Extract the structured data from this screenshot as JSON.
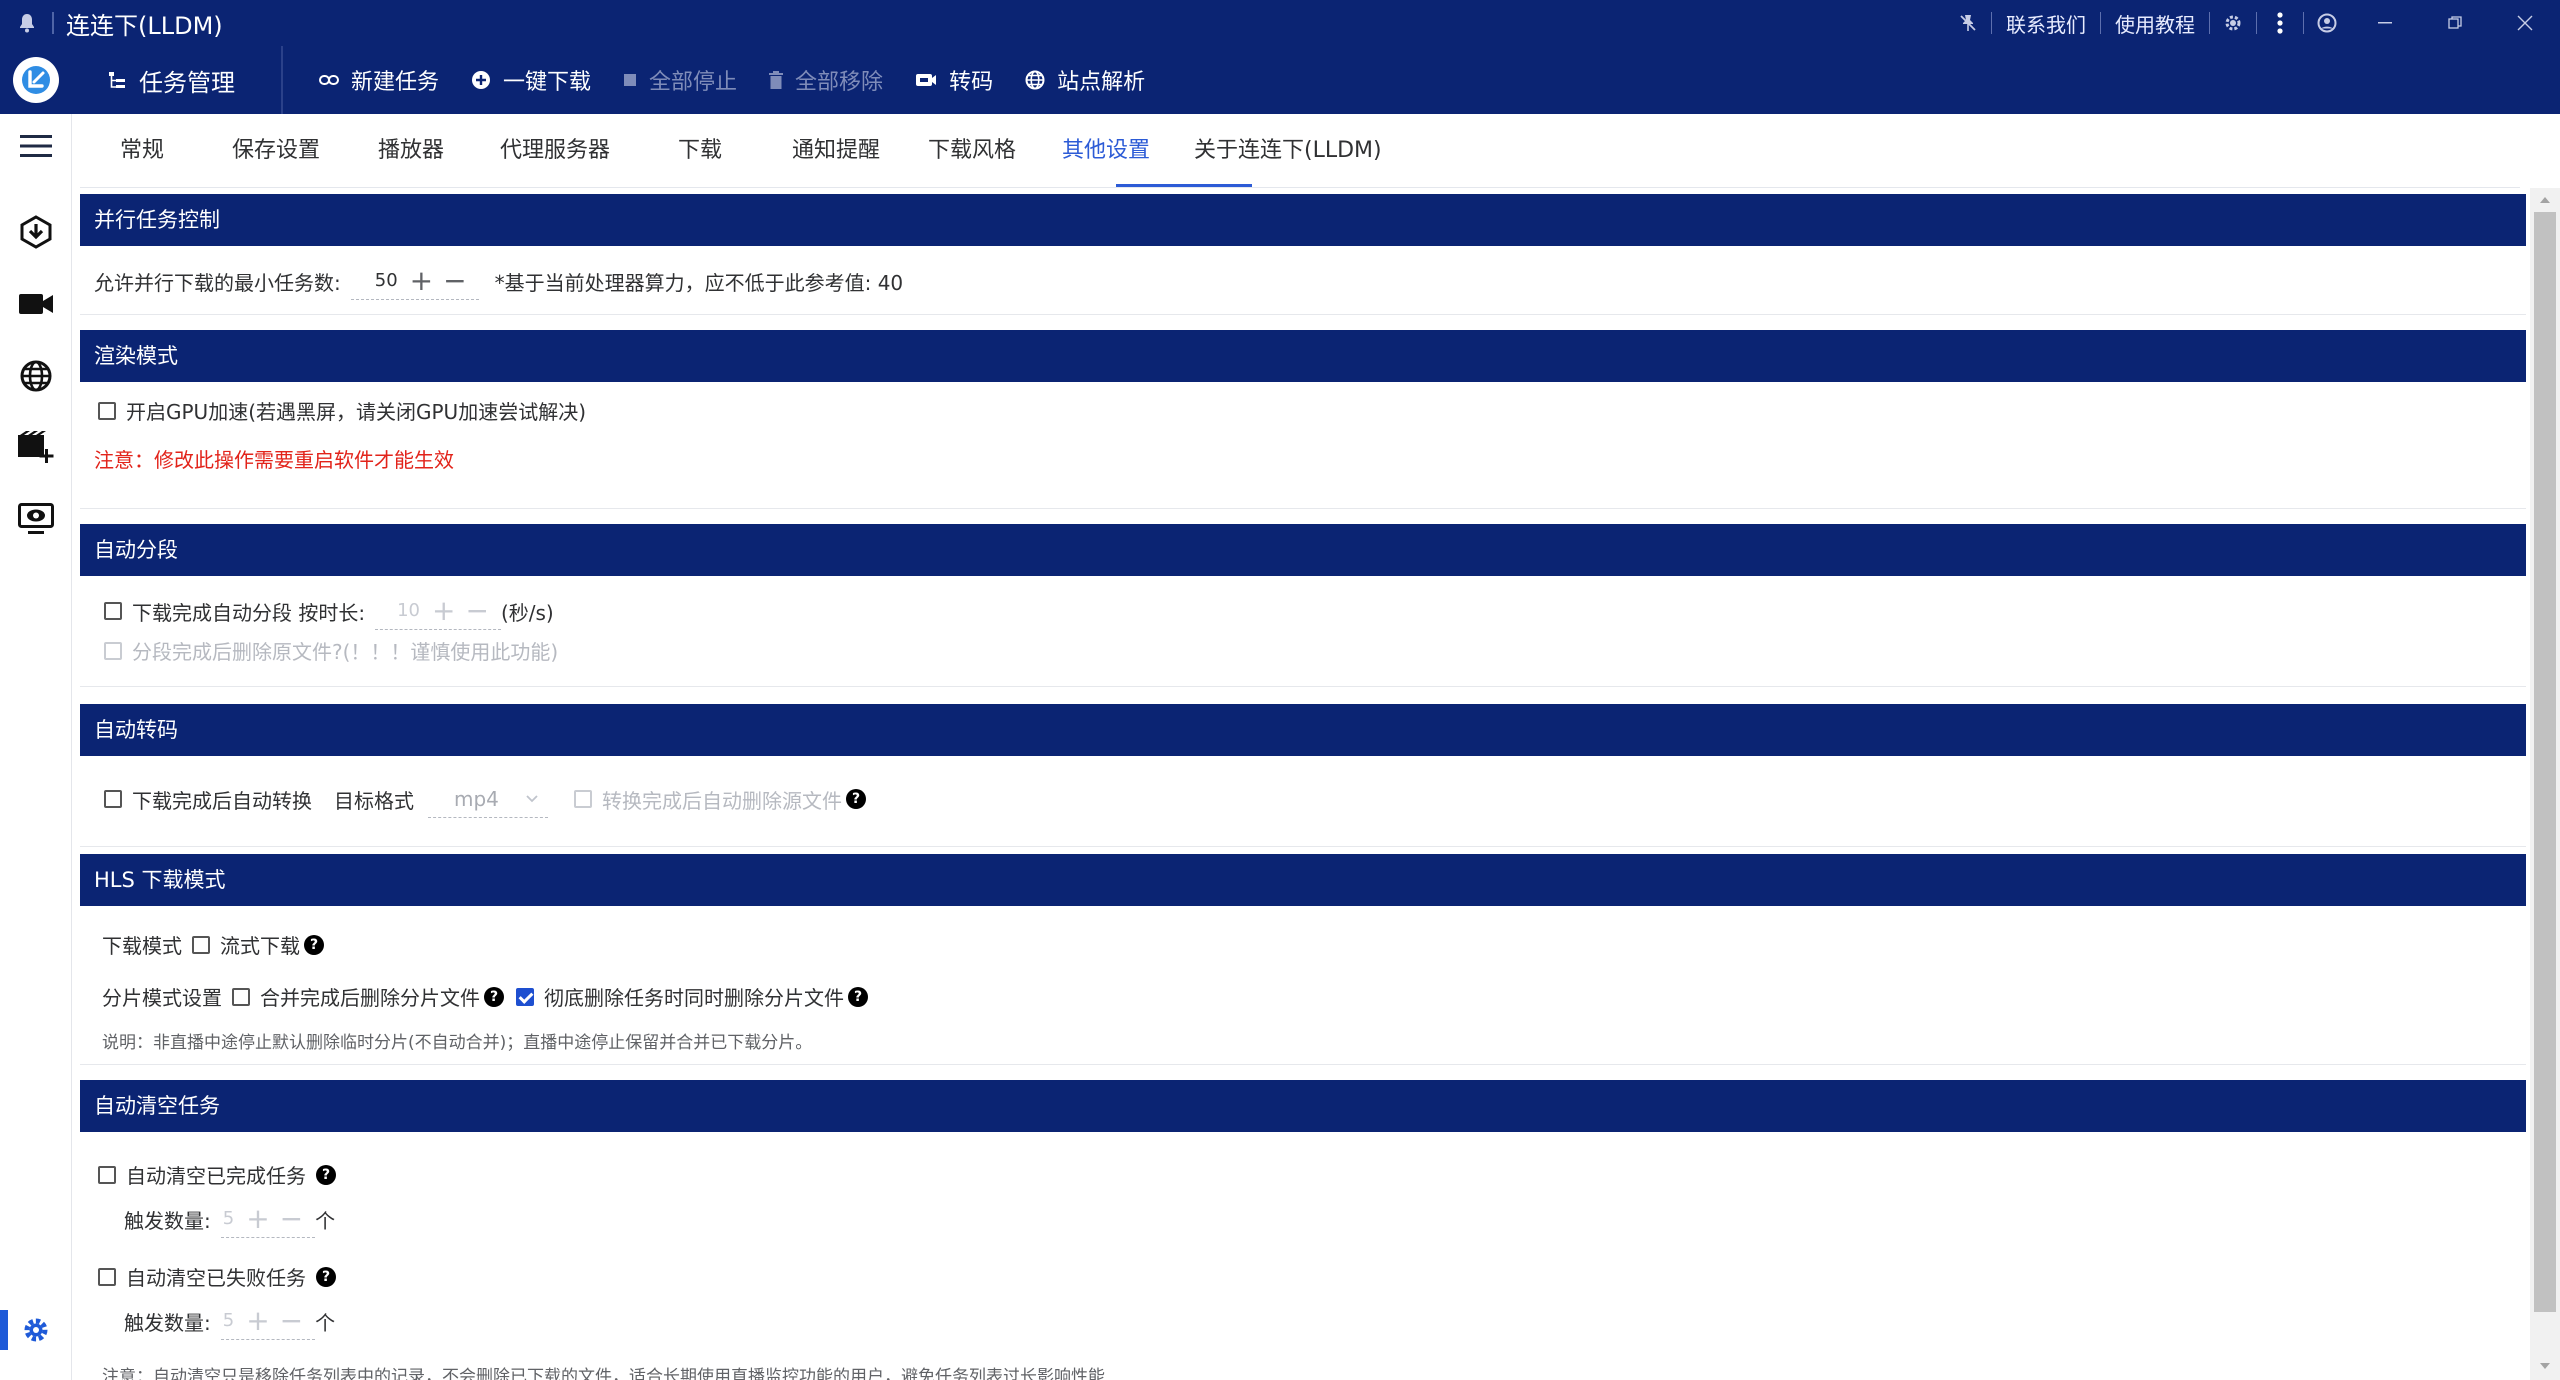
{
  "window": {
    "title": "连连下(LLDM)",
    "links": {
      "contact": "联系我们",
      "tutorial": "使用教程"
    }
  },
  "toolbar": {
    "section_title": "任务管理",
    "new_task": "新建任务",
    "one_click_download": "一键下载",
    "stop_all": "全部停止",
    "remove_all": "全部移除",
    "transcode": "转码",
    "site_parse": "站点解析"
  },
  "tabs": [
    "常规",
    "保存设置",
    "播放器",
    "代理服务器",
    "下载",
    "通知提醒",
    "下载风格",
    "其他设置",
    "关于连连下(LLDM)"
  ],
  "active_tab": "其他设置",
  "sections": {
    "parallel": {
      "title": "并行任务控制",
      "label": "允许并行下载的最小任务数:",
      "value": "50",
      "note": "*基于当前处理器算力，应不低于此参考值: 40"
    },
    "render": {
      "title": "渲染模式",
      "gpu_label": "开启GPU加速(若遇黑屏，请关闭GPU加速尝试解决)",
      "warning": "注意：修改此操作需要重启软件才能生效"
    },
    "auto_segment": {
      "title": "自动分段",
      "label": "下载完成自动分段 按时长:",
      "value": "10",
      "unit": "(秒/s)",
      "delete_label": "分段完成后删除原文件?(！！！谨慎使用此功能)"
    },
    "auto_transcode": {
      "title": "自动转码",
      "label": "下载完成后自动转换",
      "format_label": "目标格式",
      "format_value": "mp4",
      "delete_label": "转换完成后自动删除源文件"
    },
    "hls": {
      "title": "HLS 下载模式",
      "mode_label": "下载模式",
      "stream_label": "流式下载",
      "segment_label": "分片模式设置",
      "merge_delete_label": "合并完成后删除分片文件",
      "thorough_delete_label": "彻底删除任务时同时删除分片文件",
      "note": "说明：非直播中途停止默认删除临时分片(不自动合并)；直播中途停止保留并合并已下载分片。"
    },
    "auto_clear": {
      "title": "自动清空任务",
      "completed_label": "自动清空已完成任务",
      "failed_label": "自动清空已失败任务",
      "trigger_label": "触发数量:",
      "completed_value": "5",
      "failed_value": "5",
      "unit": "个",
      "note": "注意：自动清空只是移除任务列表中的记录，不会删除已下载的文件，适合长期使用直播监控功能的用户，避免任务列表过长影响性能"
    }
  },
  "colors": {
    "brand": "#0b2473",
    "accent": "#2c5bd6",
    "warning": "#e2231a"
  }
}
